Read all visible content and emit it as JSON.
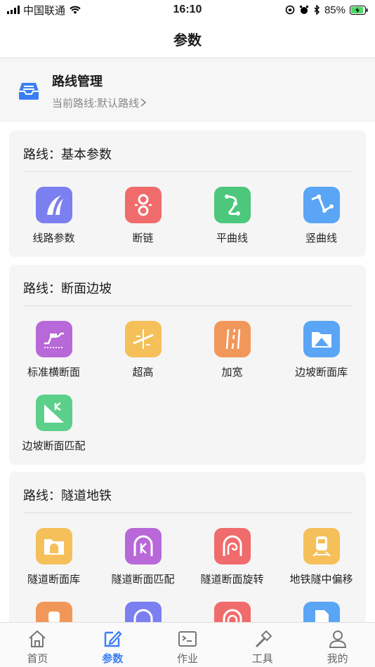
{
  "status": {
    "carrier": "中国联通",
    "time": "16:10",
    "battery": "85%"
  },
  "nav": {
    "title": "参数"
  },
  "route": {
    "title": "路线管理",
    "subtitle": "当前路线:默认路线"
  },
  "sections": [
    {
      "title": "路线：基本参数",
      "items": [
        "线路参数",
        "断链",
        "平曲线",
        "竖曲线"
      ]
    },
    {
      "title": "路线：断面边坡",
      "items": [
        "标准横断面",
        "超高",
        "加宽",
        "边坡断面库",
        "边坡断面匹配"
      ]
    },
    {
      "title": "路线：隧道地铁",
      "items": [
        "隧道断面库",
        "隧道断面匹配",
        "隧道断面旋转",
        "地铁隧中偏移"
      ]
    }
  ],
  "tabs": [
    "首页",
    "参数",
    "作业",
    "工具",
    "我的"
  ],
  "colors": {
    "accent": "#3a7ef5",
    "purple": "#7b7ff0",
    "red": "#f06b6b",
    "green": "#4cc77c",
    "blue": "#5aa5f5",
    "violet": "#b868d8",
    "yellow": "#f5c05a",
    "orange": "#f2975a",
    "mint": "#5cd08a"
  }
}
